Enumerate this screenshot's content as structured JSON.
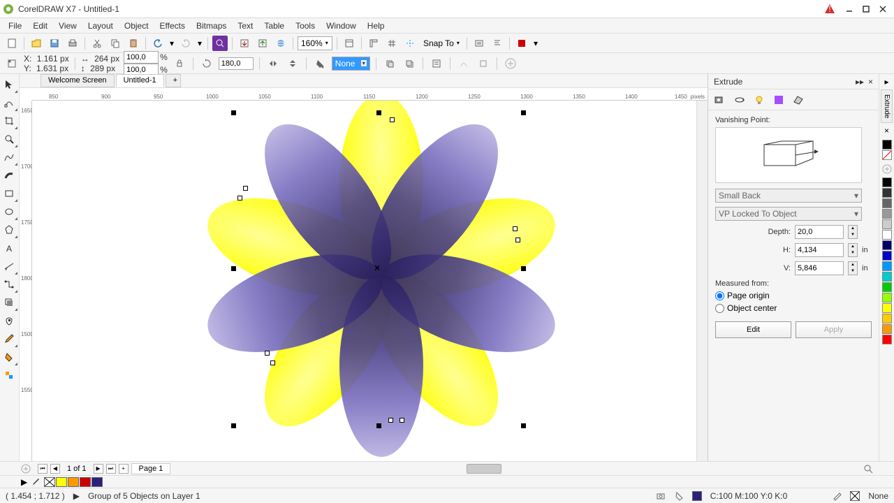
{
  "app": {
    "title": "CorelDRAW X7 - Untitled-1"
  },
  "menu": [
    "File",
    "Edit",
    "View",
    "Layout",
    "Object",
    "Effects",
    "Bitmaps",
    "Text",
    "Table",
    "Tools",
    "Window",
    "Help"
  ],
  "toolbar1": {
    "zoom": "160%",
    "snap": "Snap To"
  },
  "coords": {
    "x_label": "X:",
    "x": "1.161 px",
    "y_label": "Y:",
    "y": "1.631 px",
    "w": "264 px",
    "h": "289 px",
    "sx": "100,0",
    "sy": "100,0",
    "pct": "%",
    "rot": "180,0",
    "fill": "None"
  },
  "doctabs": {
    "welcome": "Welcome Screen",
    "untitled": "Untitled-1"
  },
  "ruler": {
    "h": [
      "850",
      "900",
      "950",
      "1000",
      "1050",
      "1100",
      "1150",
      "1200",
      "1250",
      "1300",
      "1350",
      "1400",
      "1450"
    ],
    "unit": "pixels",
    "v": [
      "1650",
      "1700",
      "1750",
      "1800",
      "1500",
      "1550"
    ]
  },
  "extrude": {
    "title": "Extrude",
    "vp_label": "Vanishing Point:",
    "preset": "Small Back",
    "lock": "VP Locked To Object",
    "depth_label": "Depth:",
    "depth": "20,0",
    "h_label": "H:",
    "h": "4,134",
    "h_unit": "in",
    "v_label": "V:",
    "v": "5,846",
    "v_unit": "in",
    "measured": "Measured from:",
    "opt1": "Page origin",
    "opt2": "Object center",
    "edit": "Edit",
    "apply": "Apply"
  },
  "pages": {
    "counter": "1 of 1",
    "page1": "Page 1"
  },
  "status": {
    "coords": "( 1.454 ; 1.712 )",
    "sel": "Group of 5 Objects on Layer 1",
    "cmyk": "C:100 M:100 Y:0 K:0",
    "none": "None"
  },
  "palette": [
    "#000",
    "#666",
    "#ccc",
    "#fff",
    "#0cf",
    "#09f",
    "#06c",
    "#039",
    "#006",
    "#0c0",
    "#090",
    "#ff0",
    "#fc0",
    "#f90",
    "#f00",
    "#c00"
  ]
}
